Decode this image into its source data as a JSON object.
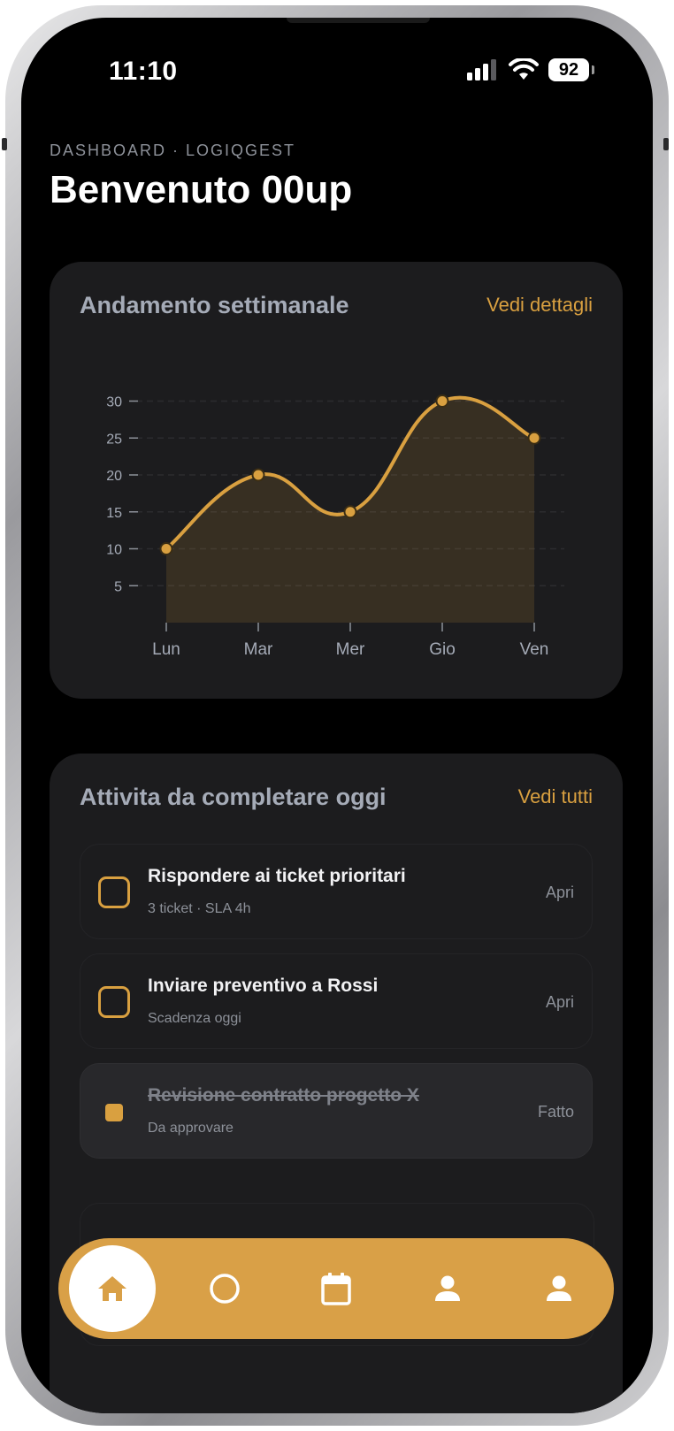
{
  "status_bar": {
    "time": "11:10",
    "battery": "92"
  },
  "header": {
    "eyebrow": "DASHBOARD · LOGIQGEST",
    "title": "Benvenuto 00up"
  },
  "weekly_card": {
    "title": "Andamento settimanale",
    "link": "Vedi dettagli"
  },
  "chart_data": {
    "type": "area",
    "categories": [
      "Lun",
      "Mar",
      "Mer",
      "Gio",
      "Ven"
    ],
    "values": [
      10,
      20,
      15,
      30,
      25
    ],
    "yticks": [
      "5",
      "10",
      "15",
      "20",
      "25",
      "30"
    ],
    "ylim": [
      0,
      30
    ],
    "grid": true,
    "color": "#d9a040"
  },
  "tasks_card": {
    "title": "Attivita da completare oggi",
    "link": "Vedi tutti",
    "items": [
      {
        "title": "Rispondere ai ticket prioritari",
        "subtitle": "3 ticket · SLA 4h",
        "action": "Apri",
        "done": false
      },
      {
        "title": "Inviare preventivo a Rossi",
        "subtitle": "Scadenza oggi",
        "action": "Apri",
        "done": false
      },
      {
        "title": "Revisione contratto progetto X",
        "subtitle": "Da approvare",
        "action": "Fatto",
        "done": true
      }
    ]
  },
  "nav": {
    "items": [
      "home-icon",
      "circle-icon",
      "calendar-icon",
      "person-icon",
      "person-icon"
    ],
    "accent": "#d9a047",
    "active": "home"
  }
}
